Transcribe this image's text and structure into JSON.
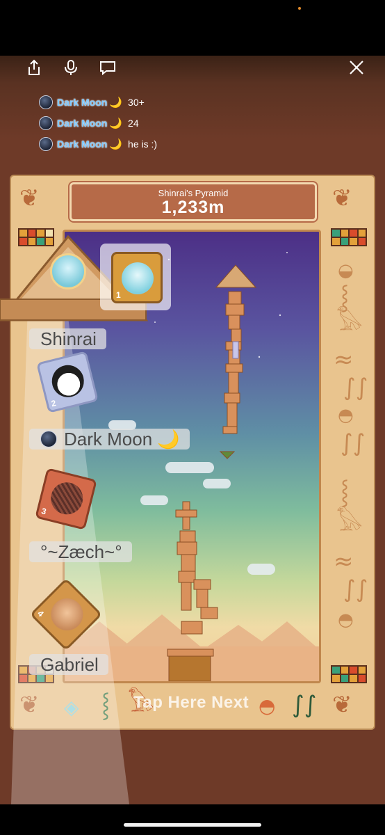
{
  "toolbar": {
    "share_icon": "share-icon",
    "mic_icon": "microphone-icon",
    "chat_icon": "chat-bubble-icon",
    "close_icon": "close-icon"
  },
  "chat": [
    {
      "name": "Dark Moon",
      "emoji": "🌙",
      "message": "30+"
    },
    {
      "name": "Dark Moon",
      "emoji": "🌙",
      "message": "24"
    },
    {
      "name": "Dark Moon",
      "emoji": "🌙",
      "message": "he is :)"
    }
  ],
  "game": {
    "title": "Shinrai's Pyramid",
    "height": "1,233m",
    "tap_prompt": "Tap Here Next"
  },
  "players": [
    {
      "rank": "1",
      "name": "Shinrai"
    },
    {
      "rank": "2",
      "name": "Dark Moon 🌙"
    },
    {
      "rank": "3",
      "name": "°~Zæch~°"
    },
    {
      "rank": "4",
      "name": "Gabriel"
    }
  ],
  "colors": {
    "accent": "#b66a48",
    "frame": "#e9c48e",
    "chat_name": "#7cc8ff",
    "background": "#6e3a28"
  }
}
